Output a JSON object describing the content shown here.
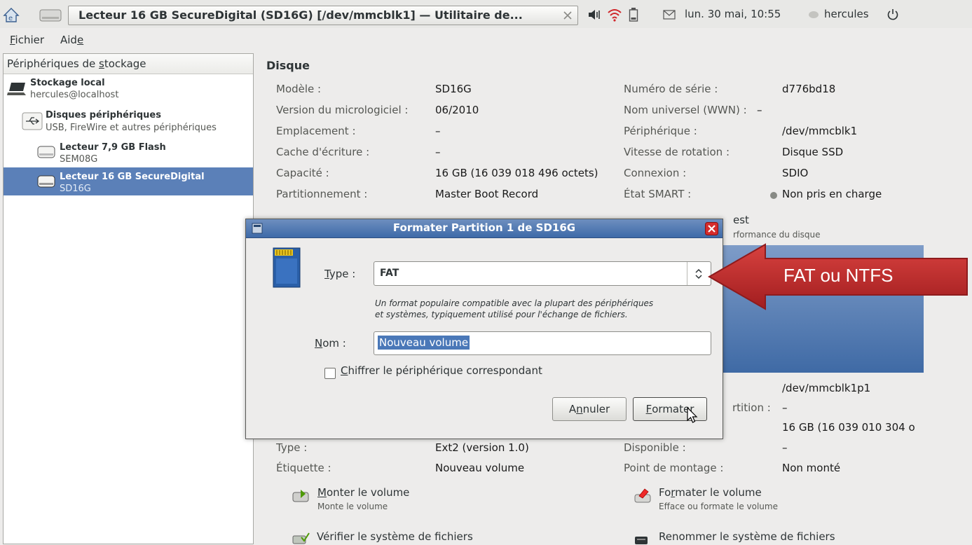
{
  "window": {
    "title": "Lecteur 16 GB SecureDigital (SD16G) [/dev/mmcblk1] — Utilitaire de..."
  },
  "panel": {
    "datetime": "lun. 30 mai, 10:55",
    "user": "hercules"
  },
  "menu": {
    "file_pre": "",
    "file_key": "F",
    "file_post": "ichier",
    "help_pre": "Aid",
    "help_key": "e",
    "help_post": ""
  },
  "sidebar": {
    "header_pre": "Périphériques de ",
    "header_key": "s",
    "header_post": "tockage",
    "local": {
      "title": "Stockage local",
      "sub": "hercules@localhost"
    },
    "peripherals": {
      "title": "Disques périphériques",
      "sub": "USB, FireWire et autres périphériques"
    },
    "flash": {
      "title": "Lecteur 7,9 GB Flash",
      "sub": "SEM08G"
    },
    "sd": {
      "title": "Lecteur 16 GB SecureDigital",
      "sub": "SD16G"
    }
  },
  "disk": {
    "heading": "Disque",
    "left": [
      {
        "label": "Modèle :",
        "value": "SD16G"
      },
      {
        "label": "Version du micrologiciel :",
        "value": "06/2010"
      },
      {
        "label": "Emplacement :",
        "value": "–"
      },
      {
        "label": "Cache d'écriture :",
        "value": "–"
      },
      {
        "label": "Capacité :",
        "value": "16 GB (16 039 018 496 octets)"
      },
      {
        "label": "Partitionnement :",
        "value": "Master Boot Record"
      }
    ],
    "right": [
      {
        "label": "Numéro de série :",
        "value": "d776bd18"
      },
      {
        "label": "Nom universel (WWN) :",
        "value": "–"
      },
      {
        "label": "Périphérique :",
        "value": "/dev/mmcblk1"
      },
      {
        "label": "Vitesse de rotation :",
        "value": "Disque SSD"
      },
      {
        "label": "Connexion :",
        "value": "SDIO"
      },
      {
        "label": "État SMART :",
        "value": "Non pris en charge"
      }
    ],
    "benchmark_title_partial": "est",
    "benchmark_sub_partial": "rformance du disque"
  },
  "volume": {
    "device": "/dev/mmcblk1p1",
    "partition_label_partial": "rtition :",
    "partition_value": "–",
    "size_value": "16 GB (16 039 010 304 o",
    "rows_left": [
      {
        "label": "Type :",
        "value": "Ext2 (version 1.0)"
      },
      {
        "label": "Étiquette :",
        "value": "Nouveau volume"
      }
    ],
    "rows_right": [
      {
        "label": "Disponible :",
        "value": "–"
      },
      {
        "label": "Point de montage :",
        "value": "Non monté"
      }
    ],
    "actions": {
      "mount": {
        "pre": "",
        "key": "M",
        "post": "onter le volume",
        "sub": "Monte le volume"
      },
      "format": {
        "pre": "Fo",
        "key": "r",
        "post": "mater le volume",
        "sub": "Efface ou formate le volume"
      },
      "check": {
        "label": "Vérifier le système de fichiers"
      },
      "rename": {
        "label": "Renommer le système de fichiers"
      }
    }
  },
  "dialog": {
    "title": "Formater Partition 1 de SD16G",
    "type_key": "T",
    "type_post": "ype :",
    "type_value": "FAT",
    "type_desc_1": "Un format populaire compatible avec la plupart des périphériques",
    "type_desc_2": "et systèmes, typiquement utilisé pour l'échange de fichiers.",
    "name_key": "N",
    "name_post": "om :",
    "name_value": "Nouveau volume",
    "encrypt_key": "C",
    "encrypt_post": "hiffrer le périphérique correspondant",
    "cancel_pre": "A",
    "cancel_key": "n",
    "cancel_post": "nuler",
    "format_key": "F",
    "format_post": "ormater"
  },
  "annotation": {
    "text": "FAT ou NTFS",
    "color": "#b8282a"
  }
}
